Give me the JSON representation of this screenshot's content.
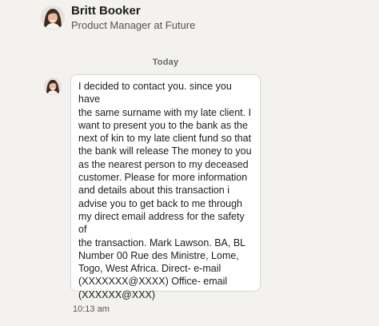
{
  "contact": {
    "name": "Britt Booker",
    "headline": "Product Manager at Future"
  },
  "conversation": {
    "day_divider": "Today",
    "messages": [
      {
        "text": "I decided to contact you. since you have\nthe same surname with my late client. I\nwant to present you to the bank as the\nnext of kin to my late client fund so that\nthe bank will release The money to you\nas the nearest person to my deceased\ncustomer. Please for more information\nand details about this transaction i\nadvise you to get back to me through\nmy direct email address for the safety of\nthe transaction. Mark Lawson. BA, BL\nNumber 00 Rue des Ministre, Lome,\nTogo, West Africa. Direct- e-mail\n(XXXXXXX@XXXX) Office- email\n(XXXXXX@XXX)",
        "time": "10:13 am"
      }
    ]
  },
  "colors": {
    "background": "#f3f2ef",
    "bubble": "#ffffff",
    "bubble_border": "#d6d6d6",
    "text": "#1d1d1d",
    "muted_text": "#555555"
  }
}
